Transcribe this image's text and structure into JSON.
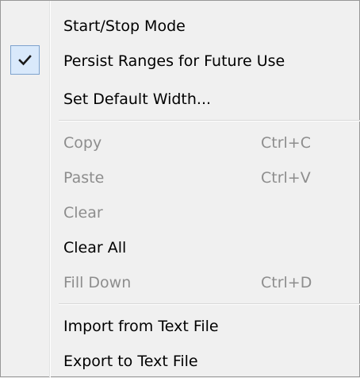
{
  "menu": {
    "items": [
      {
        "label": "Start/Stop Mode",
        "shortcut": "",
        "enabled": true
      },
      {
        "label": "Persist Ranges for Future Use",
        "shortcut": "",
        "enabled": true,
        "checked": true
      },
      {
        "label": "Set Default Width...",
        "shortcut": "",
        "enabled": true
      },
      {
        "label": "Copy",
        "shortcut": "Ctrl+C",
        "enabled": false
      },
      {
        "label": "Paste",
        "shortcut": "Ctrl+V",
        "enabled": false
      },
      {
        "label": "Clear",
        "shortcut": "",
        "enabled": false
      },
      {
        "label": "Clear All",
        "shortcut": "",
        "enabled": true
      },
      {
        "label": "Fill Down",
        "shortcut": "Ctrl+D",
        "enabled": false
      },
      {
        "label": "Import from Text File",
        "shortcut": "",
        "enabled": true
      },
      {
        "label": "Export to Text File",
        "shortcut": "",
        "enabled": true
      }
    ],
    "icons": {
      "checked": "checkmark-icon"
    },
    "colors": {
      "background": "#f0f0f0",
      "enabled_text": "#000000",
      "disabled_text": "#8d8d8d",
      "check_highlight": "#d9e9fb",
      "check_border": "#7da2ce"
    }
  }
}
